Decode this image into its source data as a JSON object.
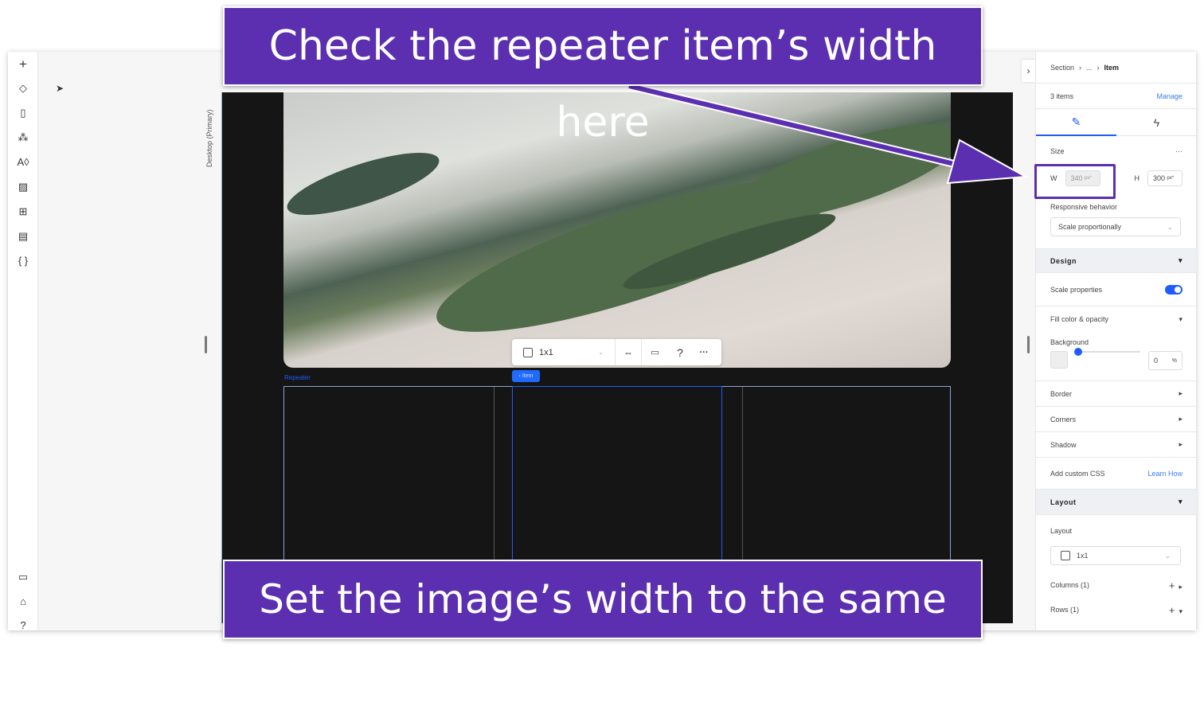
{
  "callouts": {
    "top": "Check the repeater item’s width here",
    "bottom": "Set the image’s width to the same value",
    "color": "#5b2fb0"
  },
  "left_toolbar": {
    "icons": [
      "plus-icon",
      "layers-icon",
      "page-icon",
      "apps-icon",
      "theme-icon",
      "media-icon",
      "grid-icon",
      "table-icon",
      "code-icon"
    ],
    "bottom_icons": [
      "chat-icon",
      "learn-icon",
      "help-icon"
    ]
  },
  "canvas": {
    "breakpoint_label": "Desktop (Primary)",
    "repeater_label": "Repeater",
    "item_tag": "‹ Item",
    "toolbar": {
      "layout_value": "1x1"
    }
  },
  "panel": {
    "breadcrumb": [
      "Section",
      "...",
      "Item"
    ],
    "items_count": "3 items",
    "manage": "Manage",
    "size": {
      "label": "Size",
      "w_label": "W",
      "w_value": "340",
      "h_label": "H",
      "h_value": "300",
      "unit": "px*"
    },
    "responsive": {
      "label": "Responsive behavior",
      "value": "Scale proportionally"
    },
    "design": {
      "label": "Design",
      "scale_properties": "Scale properties",
      "scale_on": true,
      "fill": "Fill color & opacity",
      "background": "Background",
      "opacity": "0",
      "opacity_unit": "%",
      "border": "Border",
      "corners": "Corners",
      "shadow": "Shadow",
      "custom_css": "Add custom CSS",
      "learn_how": "Learn How"
    },
    "layout": {
      "label": "Layout",
      "sub_label": "Layout",
      "value": "1x1",
      "columns": "Columns (1)",
      "rows": "Rows (1)"
    },
    "accent": "#1f5cff"
  }
}
